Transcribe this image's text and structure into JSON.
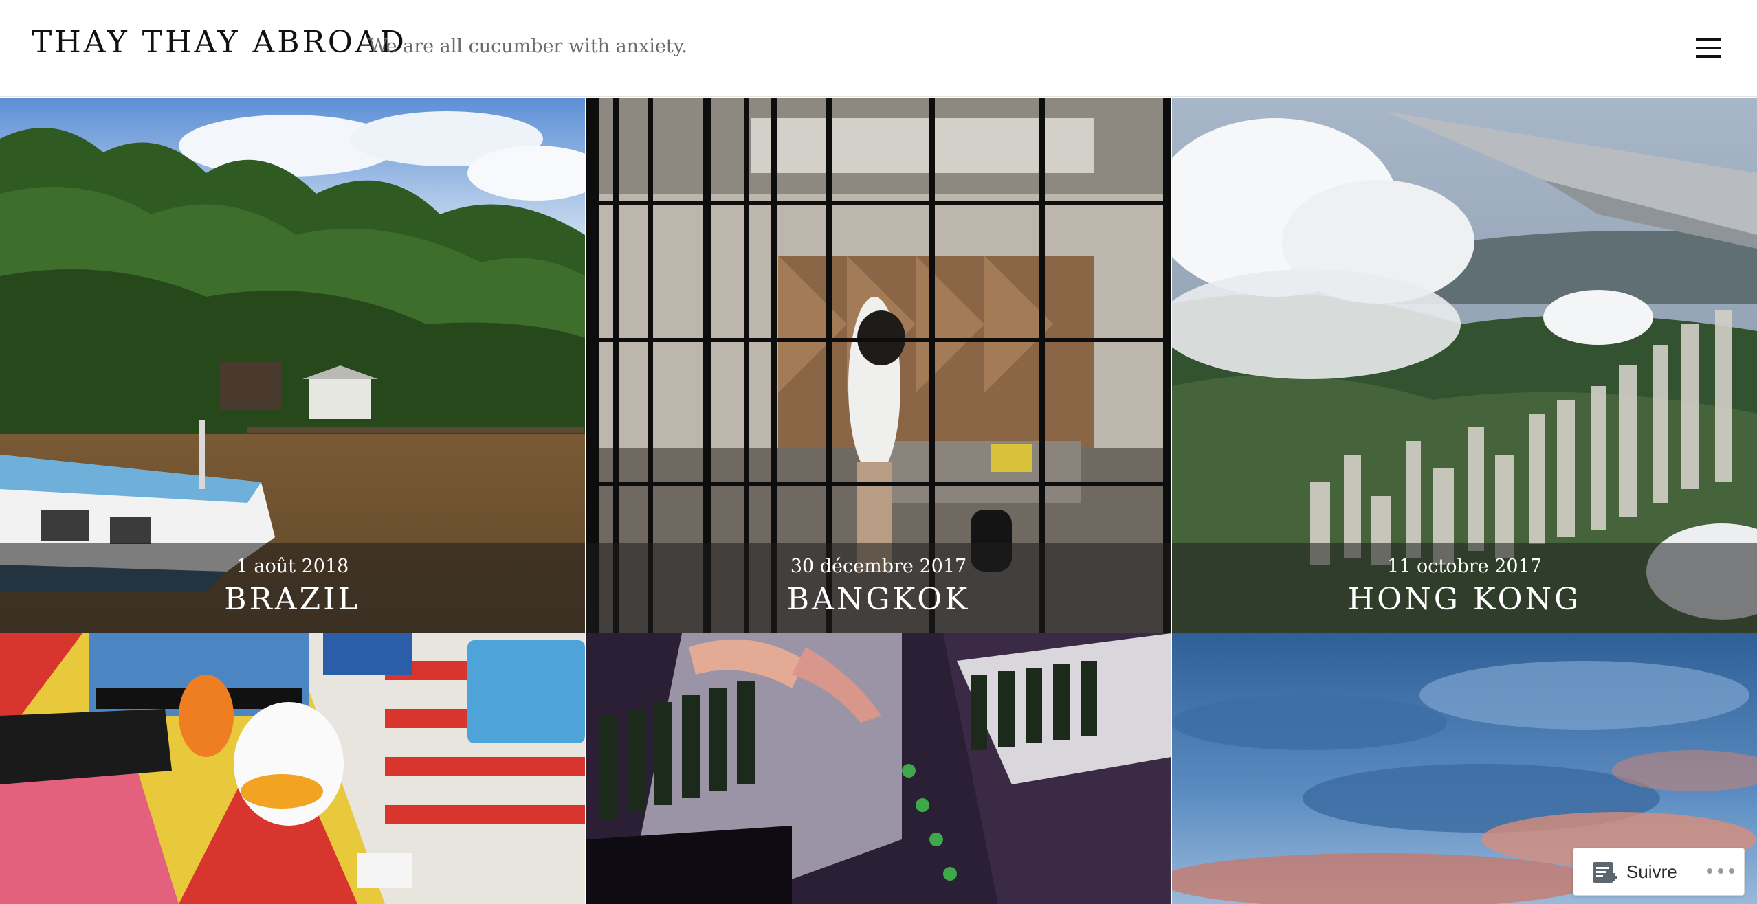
{
  "site": {
    "title": "THAY THAY ABROAD",
    "description": "We are all cucumber with anxiety."
  },
  "menu": {
    "icon": "hamburger-menu-icon"
  },
  "posts": [
    {
      "date": "1 août 2018",
      "title": "BRAZIL"
    },
    {
      "date": "30 décembre 2017",
      "title": "BANGKOK"
    },
    {
      "date": "11 octobre 2017",
      "title": "HONG KONG"
    },
    {
      "date": "",
      "title": ""
    },
    {
      "date": "",
      "title": ""
    },
    {
      "date": "",
      "title": ""
    }
  ],
  "follow": {
    "label": "Suivre",
    "icon": "reader-follow-icon",
    "more_icon": "more-dots-icon"
  },
  "colors": {
    "caption_overlay": "#1e1e1e",
    "text_dark": "#111111",
    "text_muted": "#6b6b6b"
  }
}
